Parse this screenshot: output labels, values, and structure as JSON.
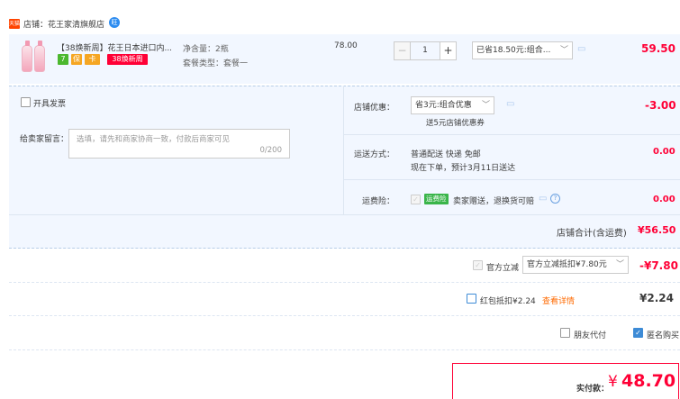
{
  "shop": {
    "icon_text": "天猫",
    "name": "店铺：花王家清旗舰店",
    "ww_icon_text": "旺"
  },
  "item": {
    "title": "【38焕新周】花王日本进口内...",
    "tags": [
      "7",
      "保",
      "卡"
    ],
    "promo_tag": "38焕新周",
    "spec1": "净含量：2瓶",
    "spec2": "套餐类型：套餐一",
    "unit_price": "78.00",
    "quantity": "1",
    "minus_label": "−",
    "plus_label": "+",
    "discount_select": "已省18.50元:组合...",
    "subtotal": "59.50"
  },
  "invoice": {
    "label": "开具发票"
  },
  "message": {
    "label": "给卖家留言：",
    "placeholder": "选填，请先和商家协商一致，付款后商家可见",
    "counter": "0/200"
  },
  "shop_discount": {
    "label": "店铺优惠：",
    "select": "省3元:组合优惠",
    "sub": "送5元店铺优惠券",
    "value": "-3.00"
  },
  "shipping": {
    "label": "运送方式：",
    "line1": "普通配送 快递 免邮",
    "line2": "现在下单，预计3月11日送达",
    "value": "0.00"
  },
  "insurance": {
    "label": "运费险：",
    "badge": "运费险",
    "text": "卖家赠送，退换货可赔",
    "help": "?",
    "value": "0.00"
  },
  "shop_total": {
    "label": "店铺合计(含运费)",
    "value": "¥56.50"
  },
  "official": {
    "label": "官方立减",
    "select": "官方立减抵扣¥7.80元",
    "value": "-¥7.80"
  },
  "redpacket": {
    "label": "红包抵扣¥2.24",
    "link": "查看详情",
    "value": "¥2.24"
  },
  "options": {
    "friend_pay": "朋友代付",
    "anonymous": "匿名购买"
  },
  "payment": {
    "label": "实付款：",
    "currency": "¥",
    "amount": "48.70"
  },
  "colors": {
    "accent_red": "#ff0036",
    "panel_bg": "#f2f7ff",
    "check_blue": "#3d8bd6"
  }
}
